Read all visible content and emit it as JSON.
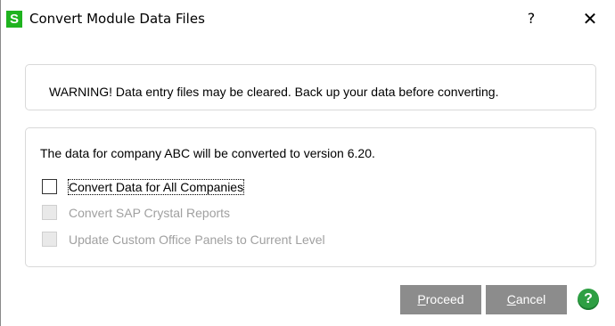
{
  "window": {
    "title": "Convert Module Data Files",
    "app_icon_letter": "S",
    "help_label": "?",
    "close_label": "✕"
  },
  "warning": {
    "text": "WARNING!  Data entry files may be cleared. Back up your data before converting."
  },
  "info": {
    "text": "The data for company ABC will be converted to version 6.20."
  },
  "options": [
    {
      "label": "Convert Data for All Companies",
      "checked": false,
      "enabled": true,
      "focused": true
    },
    {
      "label": "Convert SAP Crystal Reports",
      "checked": false,
      "enabled": false
    },
    {
      "label": "Update Custom Office Panels to Current Level",
      "checked": false,
      "enabled": false
    }
  ],
  "buttons": {
    "proceed": {
      "accel": "P",
      "rest": "roceed"
    },
    "cancel": {
      "accel": "C",
      "rest": "ancel"
    },
    "help_icon": "?"
  },
  "colors": {
    "app_icon": "#1fb31f",
    "button_bg": "#8c8c8c",
    "help_icon_bg": "#2e9f43"
  }
}
